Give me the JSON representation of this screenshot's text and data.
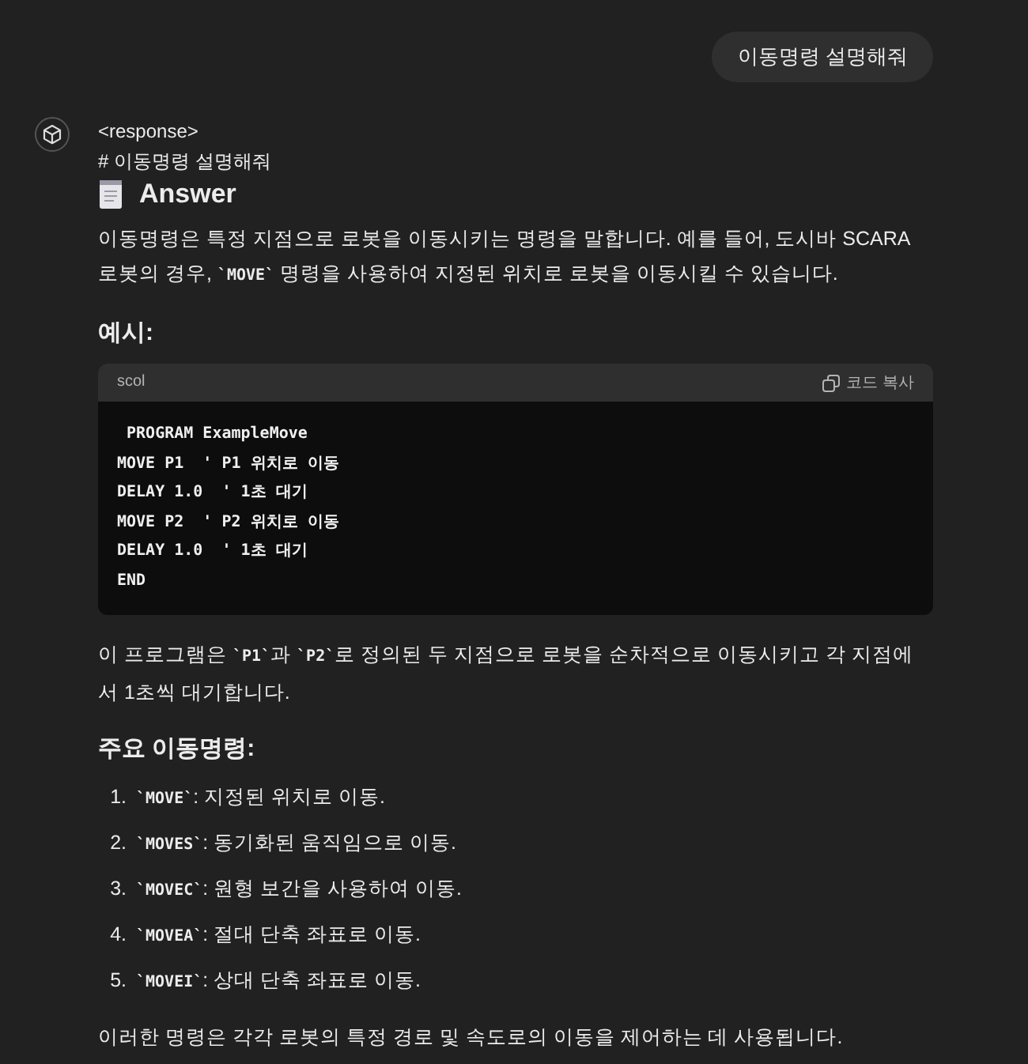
{
  "user_message": "이동명령 설명해줘",
  "response": {
    "tag": "<response>",
    "heading_line": "# 이동명령 설명해줘",
    "answer_title": "Answer",
    "intro": [
      {
        "kind": "text",
        "text": "이동명령은 특정 지점으로 로봇을 이동시키는 명령을 말합니다. 예를 들어, 도시바 SCARA 로봇의 경우, "
      },
      {
        "kind": "code",
        "text": "`MOVE`"
      },
      {
        "kind": "text",
        "text": " 명령을 사용하여 지정된 위치로 로봇을 이동시킬 수 있습니다."
      }
    ],
    "example_heading": "예시:",
    "code_block": {
      "language": "scol",
      "copy_label": "코드 복사",
      "lines": [
        " PROGRAM ExampleMove",
        "MOVE P1  ' P1 위치로 이동",
        "DELAY 1.0  ' 1초 대기",
        "MOVE P2  ' P2 위치로 이동",
        "DELAY 1.0  ' 1초 대기",
        "END"
      ]
    },
    "explanation": [
      {
        "kind": "text",
        "text": "이 프로그램은 "
      },
      {
        "kind": "code",
        "text": "`P1`"
      },
      {
        "kind": "text",
        "text": "과 "
      },
      {
        "kind": "code",
        "text": "`P2`"
      },
      {
        "kind": "text",
        "text": "로 정의된 두 지점으로 로봇을 순차적으로 이동시키고 각 지점에서 1초씩 대기합니다."
      }
    ],
    "commands_heading": "주요 이동명령:",
    "commands": [
      {
        "number": "1.",
        "code": "`MOVE`",
        "text": ": 지정된 위치로 이동."
      },
      {
        "number": "2.",
        "code": "`MOVES`",
        "text": ": 동기화된 움직임으로 이동."
      },
      {
        "number": "3.",
        "code": "`MOVEC`",
        "text": ": 원형 보간을 사용하여 이동."
      },
      {
        "number": "4.",
        "code": "`MOVEA`",
        "text": ": 절대 단축 좌표로 이동."
      },
      {
        "number": "5.",
        "code": "`MOVEI`",
        "text": ": 상대 단축 좌표로 이동."
      }
    ],
    "closing": "이러한 명령은 각각 로봇의 특정 경로 및 속도로의 이동을 제어하는 데 사용됩니다."
  }
}
